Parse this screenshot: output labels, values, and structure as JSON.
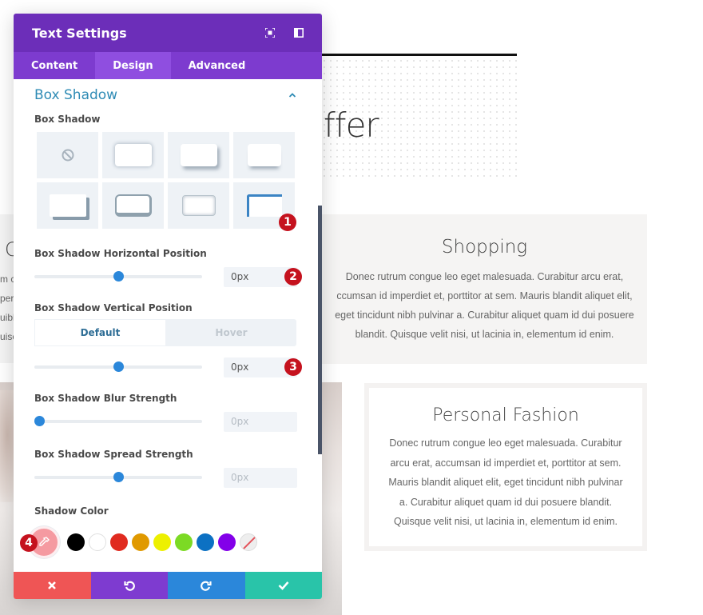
{
  "background": {
    "heading_fragment": "ffer",
    "left_card_peek": {
      "title_fragment": "C",
      "lines": [
        "m c",
        "per",
        "uibh",
        "uisc"
      ]
    },
    "shopping_card": {
      "title": "Shopping",
      "lines": [
        "Donec rutrum congue leo eget malesuada. Curabitur arcu erat,",
        "ccumsan id imperdiet et, porttitor at sem. Mauris blandit aliquet elit,",
        "eget tincidunt nibh pulvinar a. Curabitur aliquet quam id dui posuere",
        "blandit. Quisque velit nisi, ut lacinia in, elementum id enim."
      ]
    },
    "fashion_card": {
      "title": "Personal Fashion",
      "lines": [
        "Donec rutrum congue leo eget malesuada. Curabitur",
        "arcu erat, accumsan id imperdiet et, porttitor at sem.",
        "Mauris blandit aliquet elit, eget tincidunt nibh pulvinar",
        "a. Curabitur aliquet quam id dui posuere blandit.",
        "Quisque velit nisi, ut lacinia in, elementum id enim."
      ]
    }
  },
  "panel": {
    "title": "Text Settings",
    "header_icons": [
      "focus-icon",
      "sidebar-layout-icon"
    ],
    "tabs": [
      {
        "label": "Content",
        "active": false
      },
      {
        "label": "Design",
        "active": true
      },
      {
        "label": "Advanced",
        "active": false
      }
    ],
    "section_title": "Box Shadow",
    "box_shadow_label": "Box Shadow",
    "presets": [
      "none",
      "outline-soft",
      "bottom-right-soft",
      "bottom-soft",
      "bottom-right-hard",
      "border-hard",
      "inset",
      "top-left-accent"
    ],
    "selected_preset_index": 7,
    "horizontal": {
      "label": "Box Shadow Horizontal Position",
      "value": "0px",
      "slider_percent": 50
    },
    "vertical": {
      "label": "Box Shadow Vertical Position",
      "toggle": {
        "default": "Default",
        "hover": "Hover",
        "active": "Default"
      },
      "value": "0px",
      "slider_percent": 50
    },
    "blur": {
      "label": "Box Shadow Blur Strength",
      "value": "0px",
      "slider_percent": 0
    },
    "spread": {
      "label": "Box Shadow Spread Strength",
      "value": "0px",
      "slider_percent": 50
    },
    "shadow_color": {
      "label": "Shadow Color",
      "current": "#f59aa1",
      "swatches": [
        "#000000",
        "#ffffff",
        "#e02b20",
        "#e09900",
        "#edf000",
        "#7cda24",
        "#0c71c3",
        "#8300e9",
        "clear"
      ]
    },
    "badges": [
      "1",
      "2",
      "3",
      "4"
    ],
    "footer": {
      "cancel": "cancel",
      "undo": "undo",
      "redo": "redo",
      "save": "save"
    }
  }
}
